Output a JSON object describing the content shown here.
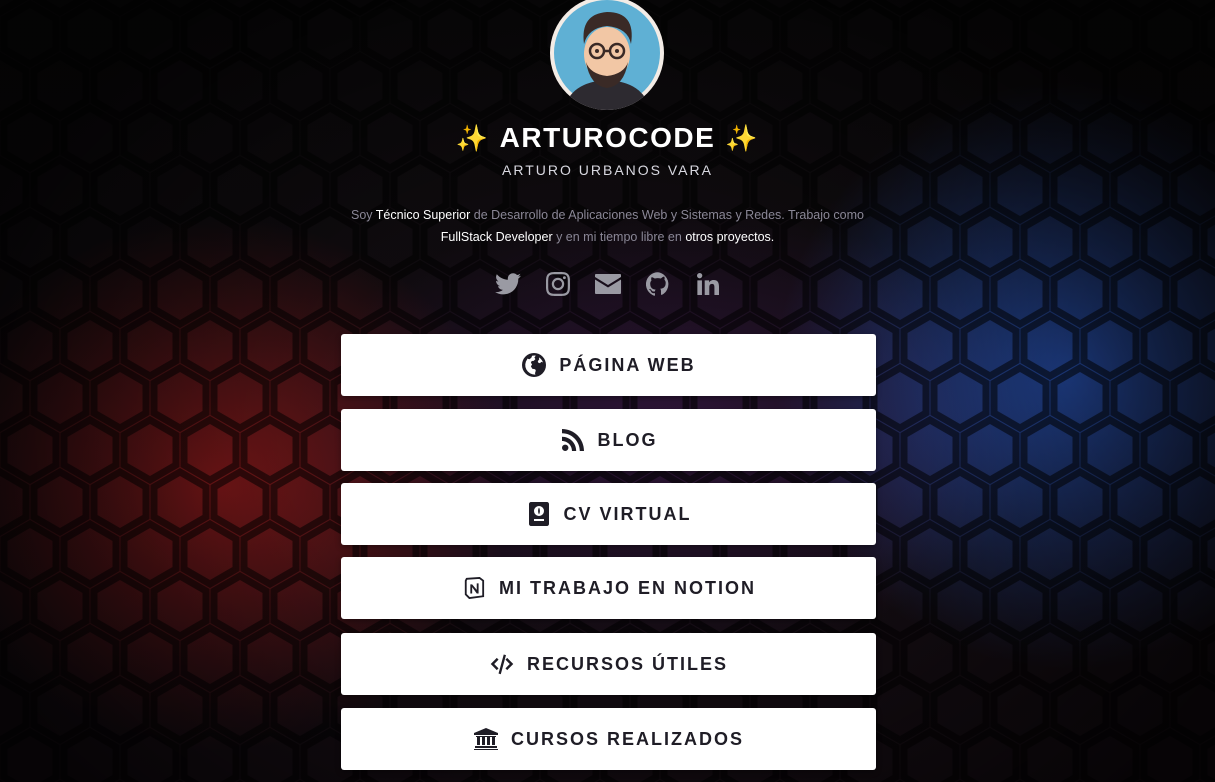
{
  "profile": {
    "sparkle_left": "✨",
    "name": "ARTUROCODE",
    "sparkle_right": "✨",
    "fullname": "ARTURO URBANOS VARA"
  },
  "bio": {
    "p1": "Soy ",
    "h1": "Técnico Superior",
    "p2": " de Desarrollo de Aplicaciones Web y Sistemas y Redes. Trabajo como ",
    "h2": "FullStack Developer",
    "p3": " y en mi tiempo libre en ",
    "h3": "otros proyectos."
  },
  "social": [
    {
      "icon": "twitter-icon"
    },
    {
      "icon": "instagram-icon"
    },
    {
      "icon": "email-icon"
    },
    {
      "icon": "github-icon"
    },
    {
      "icon": "linkedin-icon"
    }
  ],
  "links": [
    {
      "label": "PÁGINA WEB",
      "icon": "globe-icon"
    },
    {
      "label": "BLOG",
      "icon": "rss-icon"
    },
    {
      "label": "CV VIRTUAL",
      "icon": "passport-icon"
    },
    {
      "label": "MI TRABAJO EN NOTION",
      "icon": "notion-icon"
    },
    {
      "label": "RECURSOS ÚTILES",
      "icon": "code-icon"
    },
    {
      "label": "CURSOS REALIZADOS",
      "icon": "university-icon"
    }
  ],
  "colors": {
    "accent_red": "#961919",
    "accent_blue": "#285ac8",
    "button_bg": "#ffffff",
    "button_text": "#1f1d26",
    "sparkle": "#f7d64a"
  }
}
